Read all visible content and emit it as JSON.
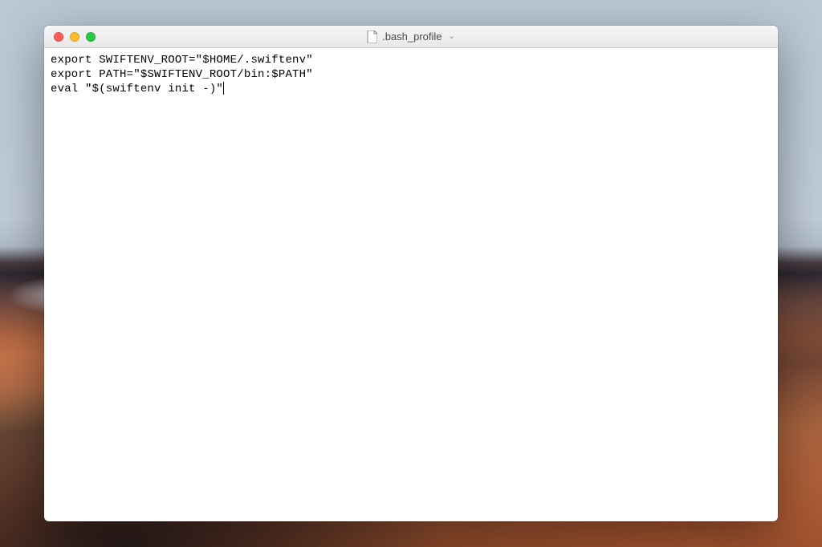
{
  "window": {
    "title": ".bash_profile",
    "doc_icon": "document-icon"
  },
  "editor": {
    "lines": [
      "export SWIFTENV_ROOT=\"$HOME/.swiftenv\"",
      "export PATH=\"$SWIFTENV_ROOT/bin:$PATH\"",
      "eval \"$(swiftenv init -)\""
    ]
  }
}
